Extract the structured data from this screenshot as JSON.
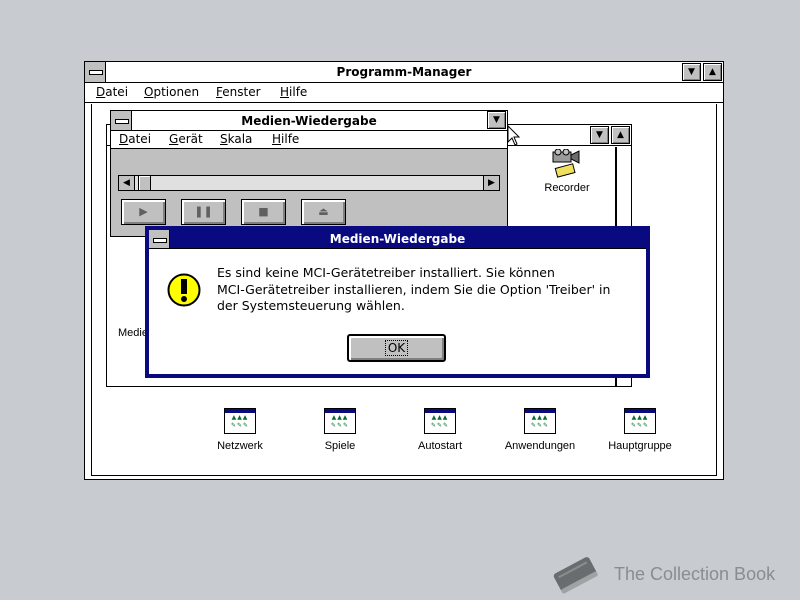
{
  "program_manager": {
    "title": "Programm-Manager",
    "menu": [
      "Datei",
      "Optionen",
      "Fenster",
      "Hilfe"
    ],
    "groups": [
      {
        "label": "Netzwerk",
        "icon": "program-group-icon"
      },
      {
        "label": "Spiele",
        "icon": "program-group-icon"
      },
      {
        "label": "Autostart",
        "icon": "program-group-icon"
      },
      {
        "label": "Anwendungen",
        "icon": "program-group-icon"
      },
      {
        "label": "Hauptgruppe",
        "icon": "program-group-icon"
      }
    ]
  },
  "group_window": {
    "icons": [
      {
        "label": "Recorder",
        "icon": "recorder-icon"
      }
    ],
    "partial_label": "Medie"
  },
  "media_player": {
    "title": "Medien-Wiedergabe",
    "menu": [
      "Datei",
      "Gerät",
      "Skala",
      "Hilfe"
    ],
    "controls": [
      {
        "name": "play",
        "glyph": "▶"
      },
      {
        "name": "pause",
        "glyph": "❚❚"
      },
      {
        "name": "stop",
        "glyph": "■"
      },
      {
        "name": "eject",
        "glyph": "⏏"
      }
    ]
  },
  "dialog": {
    "title": "Medien-Wiedergabe",
    "icon": "exclamation-icon",
    "message_lines": [
      "Es sind keine MCI-Gerätetreiber installiert. Sie können",
      "MCI-Gerätetreiber installieren, indem Sie die Option 'Treiber' in",
      "der Systemsteuerung wählen."
    ],
    "ok_label": "OK"
  },
  "watermark": {
    "text": "The Collection Book",
    "icon": "book-icon"
  },
  "colors": {
    "desktop": "#c8cbcf",
    "title_active": "#0a0a80",
    "window_face": "#c0c0c0",
    "warning_yellow": "#ffff00"
  }
}
